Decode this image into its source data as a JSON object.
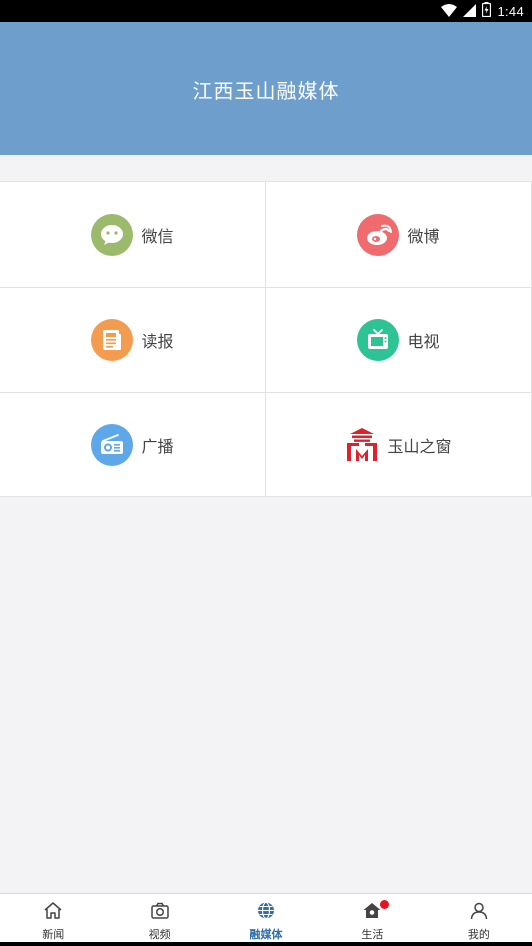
{
  "status_bar": {
    "time": "1:44",
    "icons": [
      "wifi-icon",
      "signal-icon",
      "battery-icon"
    ]
  },
  "header": {
    "title": "江西玉山融媒体"
  },
  "grid": {
    "items": [
      {
        "label": "微信",
        "icon": "wechat-icon",
        "color": "#9cba6b"
      },
      {
        "label": "微博",
        "icon": "weibo-icon",
        "color": "#ef6b6e"
      },
      {
        "label": "读报",
        "icon": "newspaper-icon",
        "color": "#f39c4f"
      },
      {
        "label": "电视",
        "icon": "tv-icon",
        "color": "#2ec394"
      },
      {
        "label": "广播",
        "icon": "radio-icon",
        "color": "#5ea7e8"
      },
      {
        "label": "玉山之窗",
        "icon": "yushan-logo-icon",
        "color": "#e0202a"
      }
    ]
  },
  "bottom_nav": {
    "active": "融媒体",
    "items": [
      {
        "label": "新闻",
        "icon": "home-icon"
      },
      {
        "label": "视频",
        "icon": "camera-icon"
      },
      {
        "label": "融媒体",
        "icon": "globe-icon",
        "color": "#2f6fad"
      },
      {
        "label": "生活",
        "icon": "house-icon",
        "badge": true,
        "badge_color": "#e6141e"
      },
      {
        "label": "我的",
        "icon": "user-icon"
      }
    ]
  }
}
